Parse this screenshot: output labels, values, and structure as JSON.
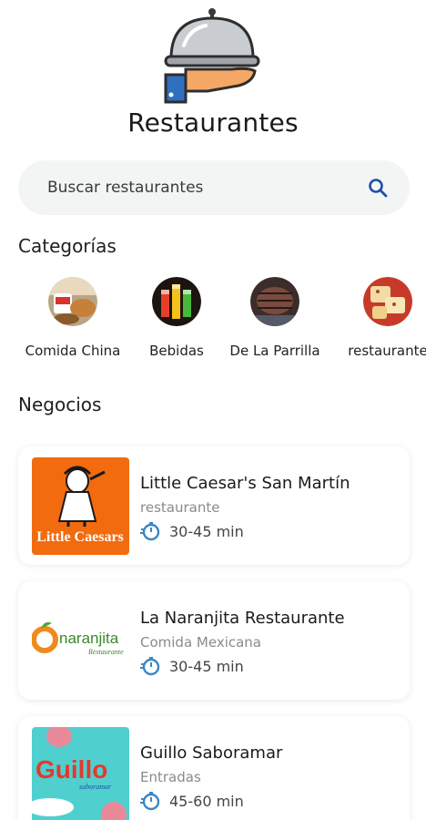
{
  "header": {
    "title": "Restaurantes",
    "logo_icon": "cloche-serving-hand-icon"
  },
  "search": {
    "placeholder": "Buscar restaurantes",
    "icon": "search-icon",
    "icon_color": "#1f4fa8"
  },
  "sections": {
    "categories_title": "Categorías",
    "businesses_title": "Negocios"
  },
  "categories": [
    {
      "label": "Comida China"
    },
    {
      "label": "Bebidas"
    },
    {
      "label": "De La Parrilla"
    },
    {
      "label": "restaurante"
    }
  ],
  "businesses": [
    {
      "name": "Little Caesar's San Martín",
      "category": "restaurante",
      "time": "30-45 min",
      "logo_text": "Little Caesars"
    },
    {
      "name": "La Naranjita Restaurante",
      "category": "Comida Mexicana",
      "time": "30-45 min",
      "logo_text": "naranjita",
      "logo_subtext": "Restaurante"
    },
    {
      "name": "Guillo Saboramar",
      "category": "Entradas",
      "time": "45-60 min",
      "logo_text": "Guillo",
      "logo_subtext": "saboramar"
    }
  ],
  "colors": {
    "accent": "#1f4fa8",
    "timer_icon": "#3a86c8",
    "little_caesars_bg": "#f26b0f",
    "naranjita_orange": "#f08a1d",
    "guillo_bg": "#4fd0cf"
  }
}
